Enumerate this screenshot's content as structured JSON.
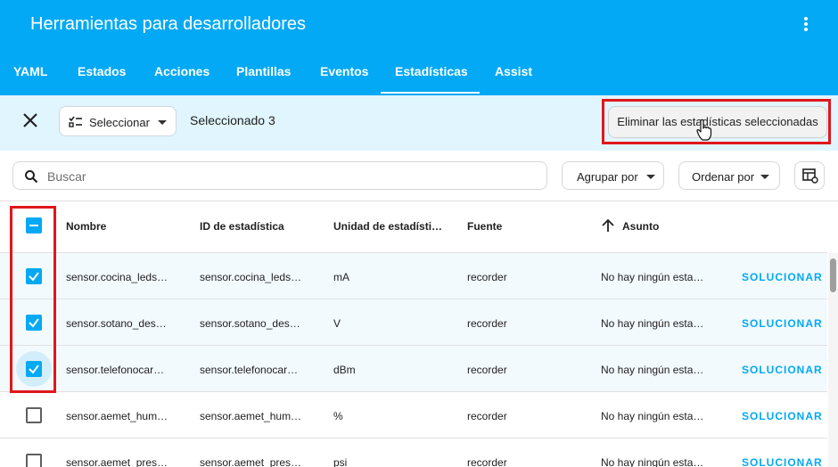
{
  "header": {
    "title": "Herramientas para desarrolladores"
  },
  "tabs": [
    {
      "label": "YAML"
    },
    {
      "label": "Estados"
    },
    {
      "label": "Acciones"
    },
    {
      "label": "Plantillas"
    },
    {
      "label": "Eventos"
    },
    {
      "label": "Estadísticas"
    },
    {
      "label": "Assist"
    }
  ],
  "active_tab": "Estadísticas",
  "selection": {
    "mode_label": "Seleccionar",
    "count_text": "Seleccionado 3",
    "delete_label": "Eliminar las estadísticas seleccionadas"
  },
  "toolbar": {
    "search_placeholder": "Buscar",
    "group_label": "Agrupar por",
    "sort_label": "Ordenar por"
  },
  "table": {
    "headers": {
      "name": "Nombre",
      "id": "ID de estadística",
      "unit": "Unidad de estadísti…",
      "source": "Fuente",
      "issue": "Asunto"
    },
    "rows": [
      {
        "name": "sensor.cocina_leds…",
        "id": "sensor.cocina_leds…",
        "unit": "mA",
        "source": "recorder",
        "issue": "No hay ningún esta…",
        "action": "SOLUCIONAR",
        "selected": true
      },
      {
        "name": "sensor.sotano_des…",
        "id": "sensor.sotano_des…",
        "unit": "V",
        "source": "recorder",
        "issue": "No hay ningún esta…",
        "action": "SOLUCIONAR",
        "selected": true
      },
      {
        "name": "sensor.telefonocar…",
        "id": "sensor.telefonocar…",
        "unit": "dBm",
        "source": "recorder",
        "issue": "No hay ningún esta…",
        "action": "SOLUCIONAR",
        "selected": true
      },
      {
        "name": "sensor.aemet_hum…",
        "id": "sensor.aemet_hum…",
        "unit": "%",
        "source": "recorder",
        "issue": "No hay ningún esta…",
        "action": "SOLUCIONAR",
        "selected": false
      },
      {
        "name": "sensor.aemet_pres…",
        "id": "sensor.aemet_pres…",
        "unit": "psi",
        "source": "recorder",
        "issue": "No hay ningún esta…",
        "action": "SOLUCIONAR",
        "selected": false
      }
    ]
  },
  "colors": {
    "primary": "#03a9f4",
    "highlight": "#e0171b",
    "selected_row": "#f3fafe",
    "selection_bar": "#e1f5fe"
  }
}
